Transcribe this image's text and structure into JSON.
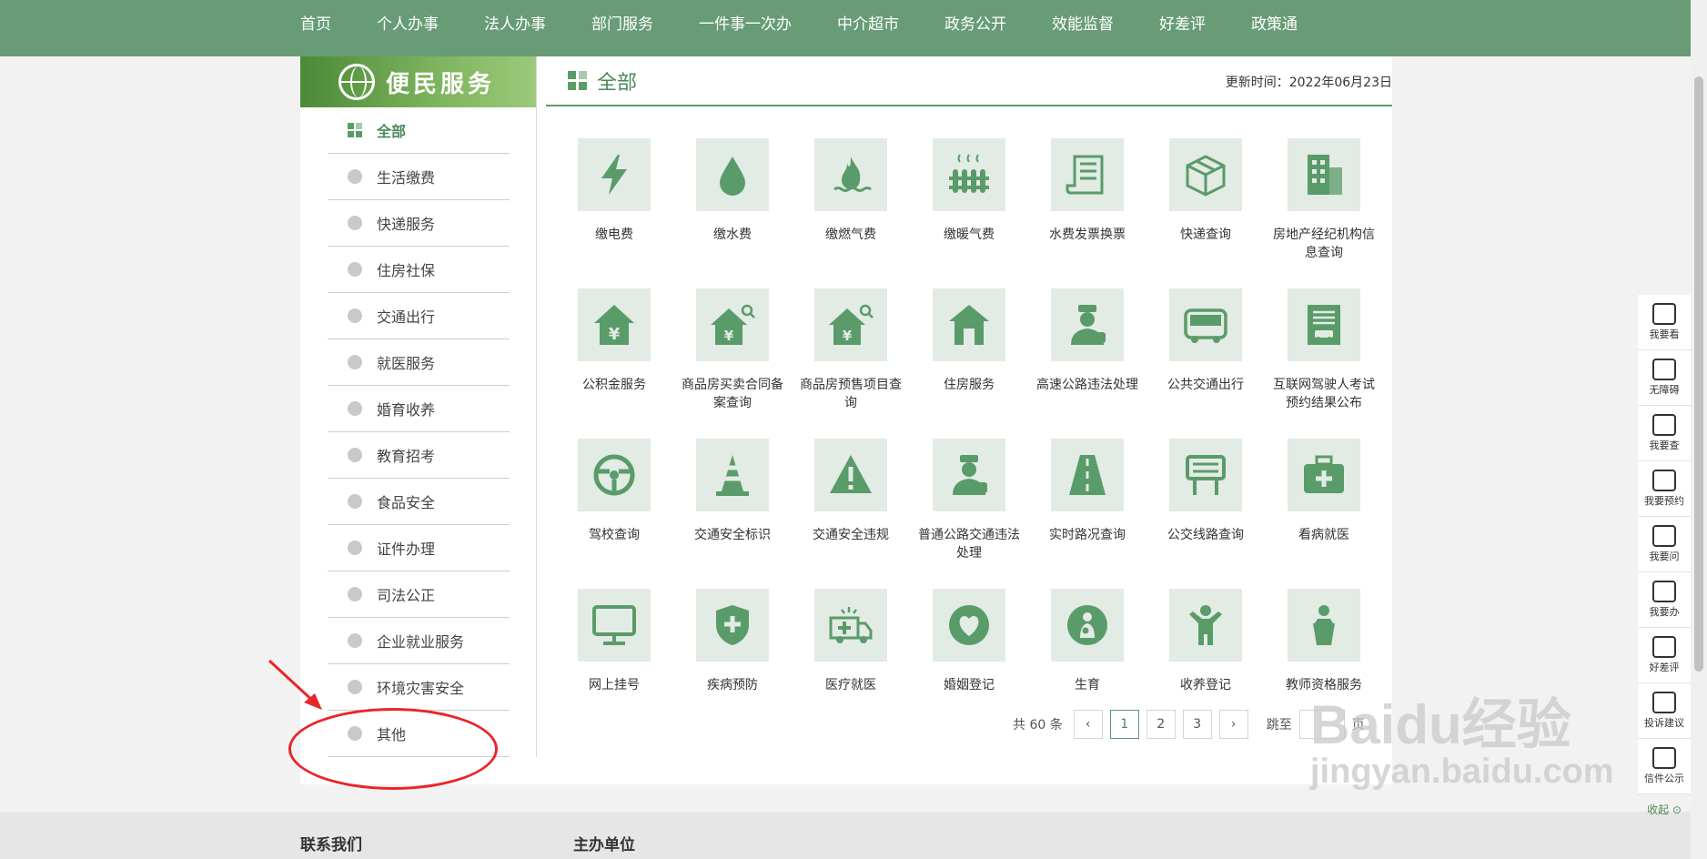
{
  "topnav": [
    "首页",
    "个人办事",
    "法人办事",
    "部门服务",
    "一件事一次办",
    "中介超市",
    "政务公开",
    "效能监督",
    "好差评",
    "政策通"
  ],
  "sidebar": {
    "title": "便民服务",
    "items": [
      "全部",
      "生活缴费",
      "快递服务",
      "住房社保",
      "交通出行",
      "就医服务",
      "婚育收养",
      "教育招考",
      "食品安全",
      "证件办理",
      "司法公正",
      "企业就业服务",
      "环境灾害安全",
      "其他"
    ],
    "active_index": 0
  },
  "main": {
    "title": "全部",
    "update_time": "更新时间：2022年06月23日",
    "services": [
      {
        "label": "缴电费",
        "icon": "lightning-icon"
      },
      {
        "label": "缴水费",
        "icon": "water-drop-icon"
      },
      {
        "label": "缴燃气费",
        "icon": "flame-icon"
      },
      {
        "label": "缴暖气费",
        "icon": "radiator-icon"
      },
      {
        "label": "水费发票换票",
        "icon": "receipt-scroll-icon"
      },
      {
        "label": "快递查询",
        "icon": "parcel-box-icon"
      },
      {
        "label": "房地产经纪机构信息查询",
        "icon": "building-icon"
      },
      {
        "label": "公积金服务",
        "icon": "house-yuan-icon"
      },
      {
        "label": "商品房买卖合同备案查询",
        "icon": "house-search-icon"
      },
      {
        "label": "商品房预售项目查询",
        "icon": "house-search-icon"
      },
      {
        "label": "住房服务",
        "icon": "house-icon"
      },
      {
        "label": "高速公路违法处理",
        "icon": "police-officer-icon"
      },
      {
        "label": "公共交通出行",
        "icon": "bus-icon"
      },
      {
        "label": "互联网驾驶人考试预约结果公布",
        "icon": "document-car-icon"
      },
      {
        "label": "驾校查询",
        "icon": "steering-wheel-icon"
      },
      {
        "label": "交通安全标识",
        "icon": "traffic-cone-icon"
      },
      {
        "label": "交通安全违规",
        "icon": "warning-triangle-icon"
      },
      {
        "label": "普通公路交通违法处理",
        "icon": "police-officer-icon"
      },
      {
        "label": "实时路况查询",
        "icon": "road-icon"
      },
      {
        "label": "公交线路查询",
        "icon": "bus-stop-sign-icon"
      },
      {
        "label": "看病就医",
        "icon": "medical-kit-icon"
      },
      {
        "label": "网上挂号",
        "icon": "monitor-icon"
      },
      {
        "label": "疾病预防",
        "icon": "shield-plus-icon"
      },
      {
        "label": "医疗就医",
        "icon": "ambulance-icon"
      },
      {
        "label": "婚姻登记",
        "icon": "heart-icon"
      },
      {
        "label": "生育",
        "icon": "mother-baby-icon"
      },
      {
        "label": "收养登记",
        "icon": "child-icon"
      },
      {
        "label": "教师资格服务",
        "icon": "teacher-podium-icon"
      }
    ]
  },
  "pager": {
    "total": "共 60 条",
    "prev": "‹",
    "pages": [
      "1",
      "2",
      "3"
    ],
    "current": "1",
    "next": "›",
    "jump": "跳至",
    "unit": "页"
  },
  "footer": {
    "contact": "联系我们",
    "host": "主办单位"
  },
  "rightbar": {
    "items": [
      "我要看",
      "无障碍",
      "我要查",
      "我要预约",
      "我要问",
      "我要办",
      "好差评",
      "投诉建议",
      "信件公示"
    ],
    "collapse": "收起 ⊙"
  },
  "watermark": {
    "main": "Baidu经验",
    "sub": "jingyan.baidu.com"
  },
  "colors": {
    "brand": "#679c76",
    "accent": "#4a8a5b",
    "tile_bg": "#e2ebe4",
    "icon": "#5a9b6a",
    "callout": "#e8262a"
  }
}
